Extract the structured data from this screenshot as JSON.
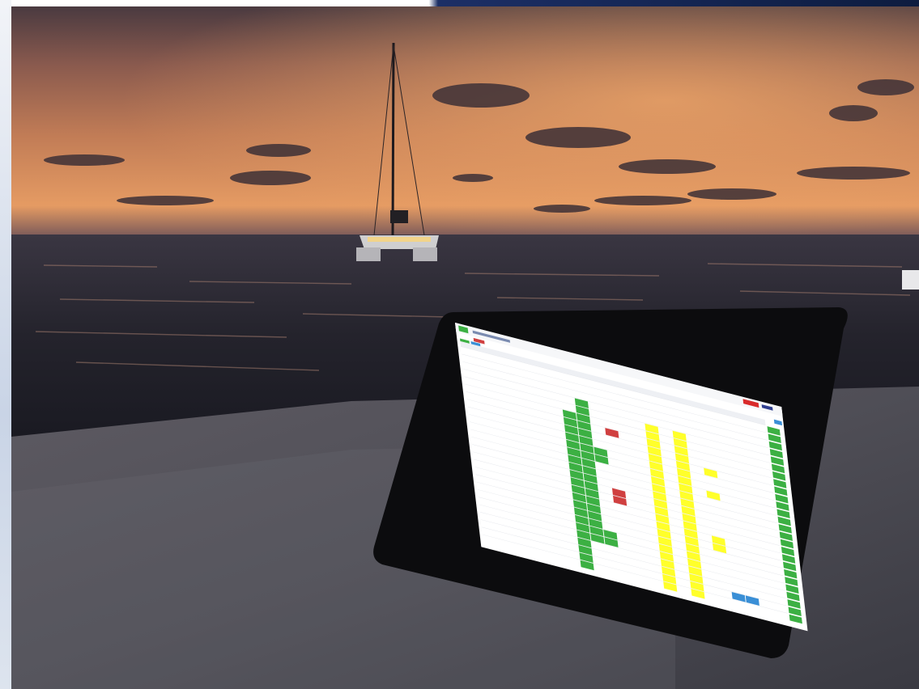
{
  "scene": {
    "description_free": true,
    "colors": {
      "sky_top": "#3a2f3a",
      "sky_mid": "#c07a55",
      "horizon_glow": "#f0a060",
      "sea": "#1c2230",
      "deck": "#4d4c52",
      "tablet_bezel": "#0b0b0d",
      "ui_green": "#3cb043",
      "ui_yellow": "#ffff2a",
      "ui_red": "#d04040",
      "ui_blue": "#3a8fd6"
    }
  },
  "tablet_app": {
    "brand_badge": "",
    "title": "",
    "columns": 22,
    "rows": 26,
    "action_button_icon": "plus-icon"
  }
}
